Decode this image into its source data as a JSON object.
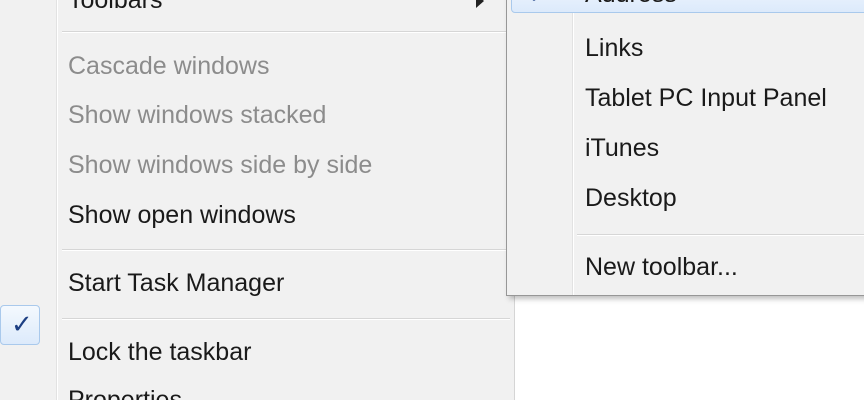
{
  "main_menu": {
    "toolbars_label": "Toolbars",
    "cascade_label": "Cascade windows",
    "stacked_label": "Show windows stacked",
    "side_by_side_label": "Show windows side by side",
    "show_open_label": "Show open windows",
    "task_manager_label": "Start Task Manager",
    "lock_taskbar_label": "Lock the taskbar",
    "lock_taskbar_checked": true,
    "check_glyph": "✓",
    "properties_label": "Properties"
  },
  "toolbars_submenu": {
    "address_label": "Address",
    "address_checked": true,
    "check_glyph": "✓",
    "links_label": "Links",
    "tablet_label": "Tablet PC Input Panel",
    "itunes_label": "iTunes",
    "desktop_label": "Desktop",
    "new_toolbar_label": "New toolbar..."
  },
  "colors": {
    "menu_background": "#f1f1f1",
    "disabled_text": "#8c8c8c",
    "highlight_border": "#a9c9ec",
    "check_color": "#1d3f83"
  }
}
